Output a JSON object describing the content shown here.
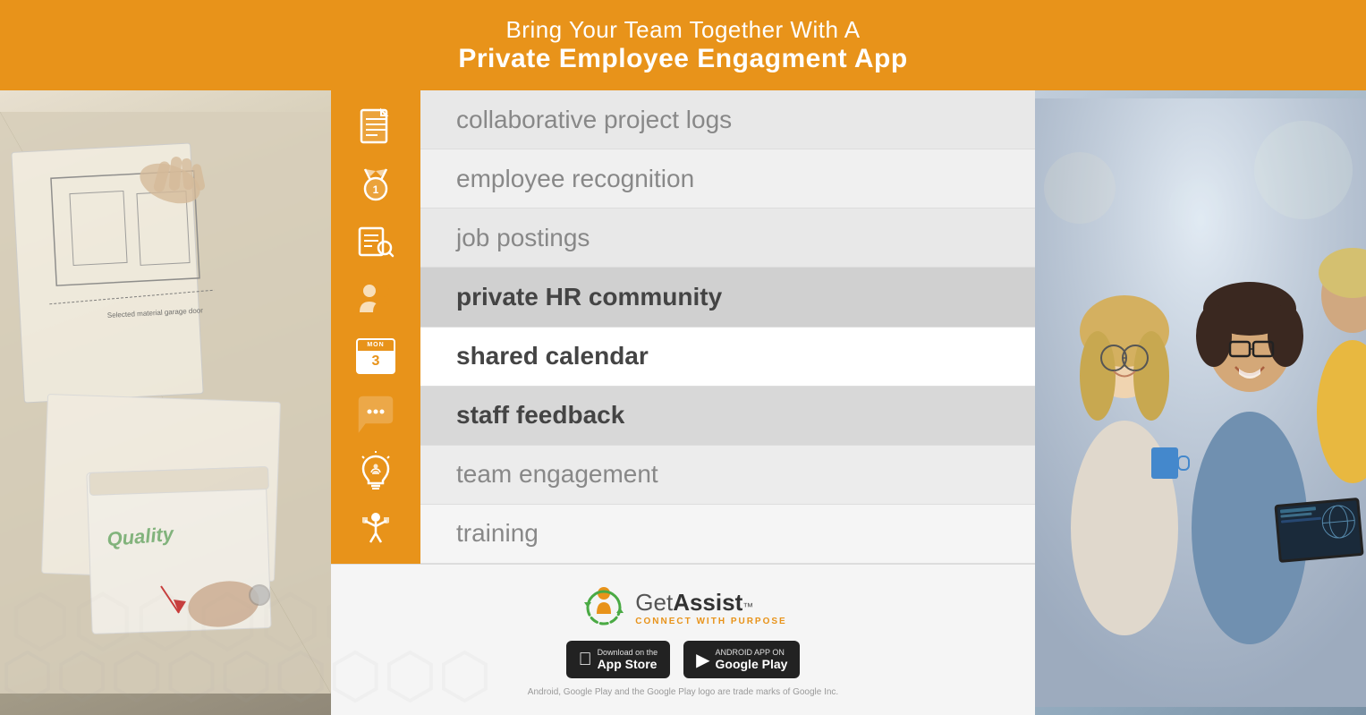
{
  "header": {
    "line1": "Bring Your Team Together With A",
    "line2": "Private Employee Engagment App"
  },
  "features": [
    {
      "id": "collaborative-project-logs",
      "label": "collaborative project logs",
      "bold": false,
      "icon": "document-icon"
    },
    {
      "id": "employee-recognition",
      "label": "employee recognition",
      "bold": false,
      "icon": "medal-icon"
    },
    {
      "id": "job-postings",
      "label": "job postings",
      "bold": false,
      "icon": "search-document-icon"
    },
    {
      "id": "private-hr-community",
      "label": "private HR community",
      "bold": true,
      "icon": "people-icon"
    },
    {
      "id": "shared-calendar",
      "label": "shared calendar",
      "bold": true,
      "icon": "calendar-icon"
    },
    {
      "id": "staff-feedback",
      "label": "staff feedback",
      "bold": true,
      "icon": "chat-icon"
    },
    {
      "id": "team-engagement",
      "label": "team engagement",
      "bold": false,
      "icon": "lightbulb-icon"
    },
    {
      "id": "training",
      "label": "training",
      "bold": false,
      "icon": "training-icon"
    }
  ],
  "brand": {
    "name_part1": "Get",
    "name_part2": "Assist",
    "trademark": "™",
    "tagline": "CONNECT WITH PURPOSE"
  },
  "stores": {
    "apple": {
      "top": "Download on the",
      "bottom": "App Store"
    },
    "google": {
      "top": "ANDROID APP ON",
      "bottom": "Google Play"
    }
  },
  "disclaimer": "Android, Google Play and the Google Play logo are trade marks of Google Inc.",
  "calendar": {
    "day": "MON",
    "date": "3"
  }
}
